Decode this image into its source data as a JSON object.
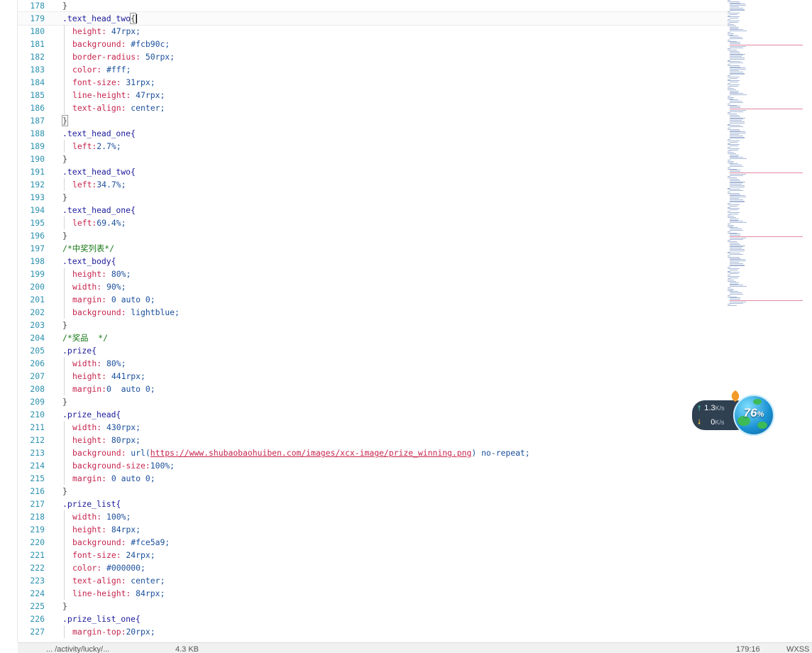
{
  "lines": [
    {
      "n": "178",
      "indent": false,
      "tokens": [
        {
          "t": "}",
          "c": "punc"
        }
      ]
    },
    {
      "n": "179",
      "current": true,
      "indent": false,
      "tokens": [
        {
          "t": ".text_head_two",
          "c": "sel"
        },
        {
          "t": "{",
          "c": "punc",
          "box": true
        },
        {
          "caret": true
        }
      ]
    },
    {
      "n": "180",
      "indent": true,
      "tokens": [
        {
          "t": "height:",
          "c": "prop"
        },
        {
          "t": " 47rpx;",
          "c": "val"
        }
      ]
    },
    {
      "n": "181",
      "indent": true,
      "tokens": [
        {
          "t": "background:",
          "c": "prop"
        },
        {
          "t": " #fcb90c;",
          "c": "val"
        }
      ]
    },
    {
      "n": "182",
      "indent": true,
      "tokens": [
        {
          "t": "border-radius:",
          "c": "prop"
        },
        {
          "t": " 50rpx;",
          "c": "val"
        }
      ]
    },
    {
      "n": "183",
      "indent": true,
      "tokens": [
        {
          "t": "color:",
          "c": "prop"
        },
        {
          "t": " #fff;",
          "c": "val"
        }
      ]
    },
    {
      "n": "184",
      "indent": true,
      "tokens": [
        {
          "t": "font-size:",
          "c": "prop"
        },
        {
          "t": " 31rpx;",
          "c": "val"
        }
      ]
    },
    {
      "n": "185",
      "indent": true,
      "tokens": [
        {
          "t": "line-height:",
          "c": "prop"
        },
        {
          "t": " 47rpx;",
          "c": "val"
        }
      ]
    },
    {
      "n": "186",
      "indent": true,
      "tokens": [
        {
          "t": "text-align:",
          "c": "prop"
        },
        {
          "t": " center;",
          "c": "val"
        }
      ]
    },
    {
      "n": "187",
      "indent": false,
      "tokens": [
        {
          "t": "}",
          "c": "punc",
          "box": true
        }
      ]
    },
    {
      "n": "188",
      "indent": false,
      "tokens": [
        {
          "t": ".text_head_one{",
          "c": "sel"
        }
      ]
    },
    {
      "n": "189",
      "indent": true,
      "tokens": [
        {
          "t": "left:",
          "c": "prop"
        },
        {
          "t": "2.7%;",
          "c": "val"
        }
      ]
    },
    {
      "n": "190",
      "indent": false,
      "tokens": [
        {
          "t": "}",
          "c": "punc"
        }
      ]
    },
    {
      "n": "191",
      "indent": false,
      "tokens": [
        {
          "t": ".text_head_two{",
          "c": "sel"
        }
      ]
    },
    {
      "n": "192",
      "indent": true,
      "tokens": [
        {
          "t": "left:",
          "c": "prop"
        },
        {
          "t": "34.7%;",
          "c": "val"
        }
      ]
    },
    {
      "n": "193",
      "indent": false,
      "tokens": [
        {
          "t": "}",
          "c": "punc"
        }
      ]
    },
    {
      "n": "194",
      "indent": false,
      "tokens": [
        {
          "t": ".text_head_one{",
          "c": "sel"
        }
      ]
    },
    {
      "n": "195",
      "indent": true,
      "tokens": [
        {
          "t": "left:",
          "c": "prop"
        },
        {
          "t": "69.4%;",
          "c": "val"
        }
      ]
    },
    {
      "n": "196",
      "indent": false,
      "tokens": [
        {
          "t": "}",
          "c": "punc"
        }
      ]
    },
    {
      "n": "197",
      "indent": false,
      "tokens": [
        {
          "t": "/*中奖列表*/",
          "c": "cmt"
        }
      ]
    },
    {
      "n": "198",
      "indent": false,
      "tokens": [
        {
          "t": ".text_body{",
          "c": "sel"
        }
      ]
    },
    {
      "n": "199",
      "indent": true,
      "tokens": [
        {
          "t": "height:",
          "c": "prop"
        },
        {
          "t": " 80%;",
          "c": "val"
        }
      ]
    },
    {
      "n": "200",
      "indent": true,
      "tokens": [
        {
          "t": "width:",
          "c": "prop"
        },
        {
          "t": " 90%;",
          "c": "val"
        }
      ]
    },
    {
      "n": "201",
      "indent": true,
      "tokens": [
        {
          "t": "margin:",
          "c": "prop"
        },
        {
          "t": " 0 auto 0;",
          "c": "val"
        }
      ]
    },
    {
      "n": "202",
      "indent": true,
      "tokens": [
        {
          "t": "background:",
          "c": "prop"
        },
        {
          "t": " lightblue;",
          "c": "val"
        }
      ]
    },
    {
      "n": "203",
      "indent": false,
      "tokens": [
        {
          "t": "}",
          "c": "punc"
        }
      ]
    },
    {
      "n": "204",
      "indent": false,
      "tokens": [
        {
          "t": "/*奖品  */",
          "c": "cmt"
        }
      ]
    },
    {
      "n": "205",
      "indent": false,
      "tokens": [
        {
          "t": ".prize{",
          "c": "sel"
        }
      ]
    },
    {
      "n": "206",
      "indent": true,
      "tokens": [
        {
          "t": "width:",
          "c": "prop"
        },
        {
          "t": " 80%;",
          "c": "val"
        }
      ]
    },
    {
      "n": "207",
      "indent": true,
      "tokens": [
        {
          "t": "height:",
          "c": "prop"
        },
        {
          "t": " 441rpx;",
          "c": "val"
        }
      ]
    },
    {
      "n": "208",
      "indent": true,
      "tokens": [
        {
          "t": "margin:",
          "c": "prop"
        },
        {
          "t": "0  auto 0;",
          "c": "val"
        }
      ]
    },
    {
      "n": "209",
      "indent": false,
      "tokens": [
        {
          "t": "}",
          "c": "punc"
        }
      ]
    },
    {
      "n": "210",
      "indent": false,
      "tokens": [
        {
          "t": ".prize_head{",
          "c": "sel"
        }
      ]
    },
    {
      "n": "211",
      "indent": true,
      "tokens": [
        {
          "t": "width:",
          "c": "prop"
        },
        {
          "t": " 430rpx;",
          "c": "val"
        }
      ]
    },
    {
      "n": "212",
      "indent": true,
      "tokens": [
        {
          "t": "height:",
          "c": "prop"
        },
        {
          "t": " 80rpx;",
          "c": "val"
        }
      ]
    },
    {
      "n": "213",
      "indent": true,
      "tokens": [
        {
          "t": "background:",
          "c": "prop"
        },
        {
          "t": " url(",
          "c": "val"
        },
        {
          "t": "https://www.shubaobaohuiben.com/images/xcx-image/prize_winning.png",
          "c": "url"
        },
        {
          "t": ") no-repeat;",
          "c": "val"
        }
      ]
    },
    {
      "n": "214",
      "indent": true,
      "tokens": [
        {
          "t": "background-size:",
          "c": "prop"
        },
        {
          "t": "100%;",
          "c": "val"
        }
      ]
    },
    {
      "n": "215",
      "indent": true,
      "tokens": [
        {
          "t": "margin:",
          "c": "prop"
        },
        {
          "t": " 0 auto 0;",
          "c": "val"
        }
      ]
    },
    {
      "n": "216",
      "indent": false,
      "tokens": [
        {
          "t": "}",
          "c": "punc"
        }
      ]
    },
    {
      "n": "217",
      "indent": false,
      "tokens": [
        {
          "t": ".prize_list{",
          "c": "sel"
        }
      ]
    },
    {
      "n": "218",
      "indent": true,
      "tokens": [
        {
          "t": "width:",
          "c": "prop"
        },
        {
          "t": " 100%;",
          "c": "val"
        }
      ]
    },
    {
      "n": "219",
      "indent": true,
      "tokens": [
        {
          "t": "height:",
          "c": "prop"
        },
        {
          "t": " 84rpx;",
          "c": "val"
        }
      ]
    },
    {
      "n": "220",
      "indent": true,
      "tokens": [
        {
          "t": "background:",
          "c": "prop"
        },
        {
          "t": " #fce5a9;",
          "c": "val"
        }
      ]
    },
    {
      "n": "221",
      "indent": true,
      "tokens": [
        {
          "t": "font-size:",
          "c": "prop"
        },
        {
          "t": " 24rpx;",
          "c": "val"
        }
      ]
    },
    {
      "n": "222",
      "indent": true,
      "tokens": [
        {
          "t": "color:",
          "c": "prop"
        },
        {
          "t": " #000000;",
          "c": "val"
        }
      ]
    },
    {
      "n": "223",
      "indent": true,
      "tokens": [
        {
          "t": "text-align:",
          "c": "prop"
        },
        {
          "t": " center;",
          "c": "val"
        }
      ]
    },
    {
      "n": "224",
      "indent": true,
      "tokens": [
        {
          "t": "line-height:",
          "c": "prop"
        },
        {
          "t": " 84rpx;",
          "c": "val"
        }
      ]
    },
    {
      "n": "225",
      "indent": false,
      "tokens": [
        {
          "t": "}",
          "c": "punc"
        }
      ]
    },
    {
      "n": "226",
      "indent": false,
      "tokens": [
        {
          "t": ".prize_list_one{",
          "c": "sel"
        }
      ]
    },
    {
      "n": "227",
      "indent": true,
      "tokens": [
        {
          "t": "margin-top:",
          "c": "prop"
        },
        {
          "t": "20rpx;",
          "c": "val"
        }
      ]
    }
  ],
  "statusbar": {
    "path": "... /activity/lucky/...",
    "size": "4.3 KB",
    "position": "179:16",
    "encoding": "WXSS"
  },
  "network": {
    "upload": "1.3",
    "upload_unit": "K/s",
    "download": "0",
    "download_unit": "K/s",
    "percent": "76",
    "percent_sign": "%"
  },
  "colors": {
    "selector": "#1a1a9b",
    "property": "#c7254e",
    "value": "#1a4f9c",
    "comment": "#1b7a1b",
    "line_number": "#2b91af"
  }
}
